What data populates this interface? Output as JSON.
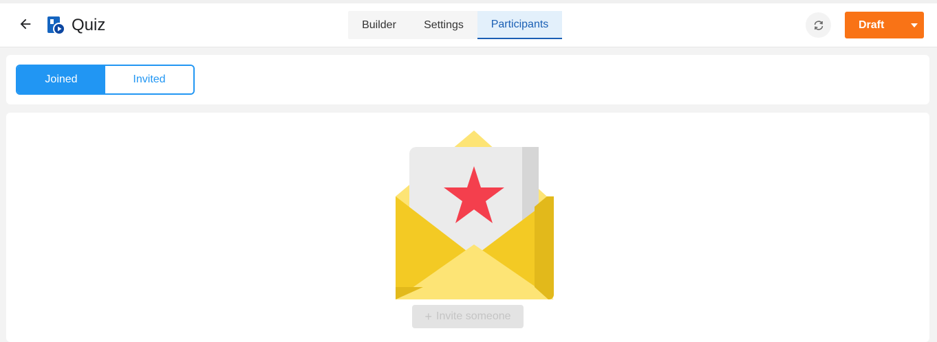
{
  "header": {
    "title": "Quiz",
    "tabs": {
      "builder": "Builder",
      "settings": "Settings",
      "participants": "Participants"
    },
    "status_button": "Draft"
  },
  "filter": {
    "joined": "Joined",
    "invited": "Invited"
  },
  "empty_state": {
    "invite_label": "Invite someone",
    "plus": "+"
  },
  "colors": {
    "accent": "#2196f3",
    "tab_active": "#1a5fb4",
    "draft": "#f97316",
    "envelope": "#f3ca24",
    "star": "#f43f4d"
  }
}
